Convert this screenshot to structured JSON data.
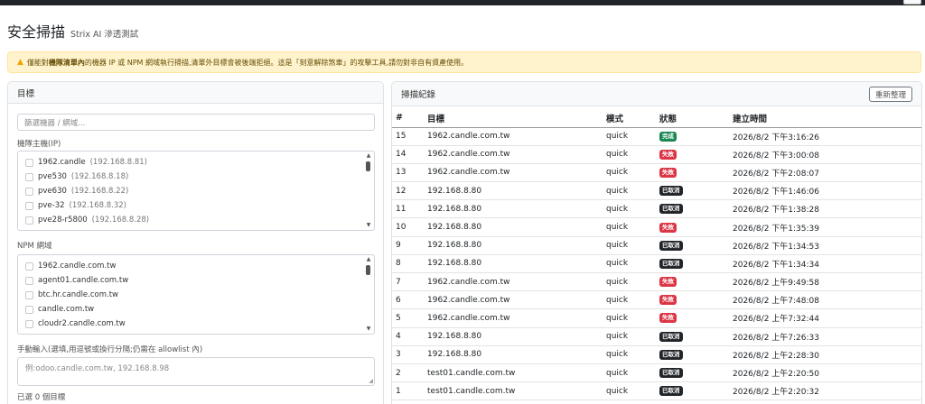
{
  "header": {
    "title": "安全掃描",
    "subtitle": "Strix AI 滲透測試"
  },
  "alert": {
    "prefix": "僅能對",
    "bold": "機隊清單內",
    "suffix": "的機器 IP 或 NPM 網域執行掃描,清單外目標會被後端拒絕。這是「刻意解除煞車」的攻擊工具,請勿對非自有資產使用。"
  },
  "targets_panel": {
    "title": "目標",
    "filter_placeholder": "篩選機器 / 網域...",
    "hosts_label": "機隊主機(IP)",
    "hosts": [
      {
        "name": "1962.candle",
        "ip": "(192.168.8.81)"
      },
      {
        "name": "pve530",
        "ip": "(192.168.8.18)"
      },
      {
        "name": "pve630",
        "ip": "(192.168.8.22)"
      },
      {
        "name": "pve-32",
        "ip": "(192.168.8.32)"
      },
      {
        "name": "pve28-r5800",
        "ip": "(192.168.8.28)"
      }
    ],
    "npm_label": "NPM 網域",
    "domains": [
      "1962.candle.com.tw",
      "agent01.candle.com.tw",
      "btc.hr.candle.com.tw",
      "candle.com.tw",
      "cloudr2.candle.com.tw"
    ],
    "manual_label": "手動輸入(選填,用逗號或換行分隔;仍需在 allowlist 內)",
    "manual_placeholder": "例:odoo.candle.com.tw, 192.168.8.98",
    "selected_count": "已選 0 個目標"
  },
  "history_panel": {
    "title": "掃描紀錄",
    "reset_label": "重新整理",
    "columns": [
      "#",
      "目標",
      "模式",
      "狀態",
      "建立時間"
    ],
    "rows": [
      {
        "id": "15",
        "target": "1962.candle.com.tw",
        "mode": "quick",
        "status": "完成",
        "kind": "done",
        "created": "2026/8/2 下午3:16:26"
      },
      {
        "id": "14",
        "target": "1962.candle.com.tw",
        "mode": "quick",
        "status": "失敗",
        "kind": "fail",
        "created": "2026/8/2 下午3:00:08"
      },
      {
        "id": "13",
        "target": "1962.candle.com.tw",
        "mode": "quick",
        "status": "失敗",
        "kind": "fail",
        "created": "2026/8/2 下午2:08:07"
      },
      {
        "id": "12",
        "target": "192.168.8.80",
        "mode": "quick",
        "status": "已取消",
        "kind": "cancel",
        "created": "2026/8/2 下午1:46:06"
      },
      {
        "id": "11",
        "target": "192.168.8.80",
        "mode": "quick",
        "status": "已取消",
        "kind": "cancel",
        "created": "2026/8/2 下午1:38:28"
      },
      {
        "id": "10",
        "target": "192.168.8.80",
        "mode": "quick",
        "status": "失敗",
        "kind": "fail",
        "created": "2026/8/2 下午1:35:39"
      },
      {
        "id": "9",
        "target": "192.168.8.80",
        "mode": "quick",
        "status": "已取消",
        "kind": "cancel",
        "created": "2026/8/2 下午1:34:53"
      },
      {
        "id": "8",
        "target": "192.168.8.80",
        "mode": "quick",
        "status": "已取消",
        "kind": "cancel",
        "created": "2026/8/2 下午1:34:34"
      },
      {
        "id": "7",
        "target": "1962.candle.com.tw",
        "mode": "quick",
        "status": "失敗",
        "kind": "fail",
        "created": "2026/8/2 上午9:49:58"
      },
      {
        "id": "6",
        "target": "1962.candle.com.tw",
        "mode": "quick",
        "status": "失敗",
        "kind": "fail",
        "created": "2026/8/2 上午7:48:08"
      },
      {
        "id": "5",
        "target": "1962.candle.com.tw",
        "mode": "quick",
        "status": "失敗",
        "kind": "fail",
        "created": "2026/8/2 上午7:32:44"
      },
      {
        "id": "4",
        "target": "192.168.8.80",
        "mode": "quick",
        "status": "已取消",
        "kind": "cancel",
        "created": "2026/8/2 上午7:26:33"
      },
      {
        "id": "3",
        "target": "192.168.8.80",
        "mode": "quick",
        "status": "已取消",
        "kind": "cancel",
        "created": "2026/8/2 上午2:28:30"
      },
      {
        "id": "2",
        "target": "test01.candle.com.tw",
        "mode": "quick",
        "status": "已取消",
        "kind": "cancel",
        "created": "2026/8/2 上午2:20:50"
      },
      {
        "id": "1",
        "target": "test01.candle.com.tw",
        "mode": "quick",
        "status": "已取消",
        "kind": "cancel",
        "created": "2026/8/2 上午2:20:32"
      }
    ]
  },
  "colors": {
    "done": "#198754",
    "fail": "#dc3545",
    "cancel": "#212529",
    "alert_bg": "#fff3cd"
  }
}
